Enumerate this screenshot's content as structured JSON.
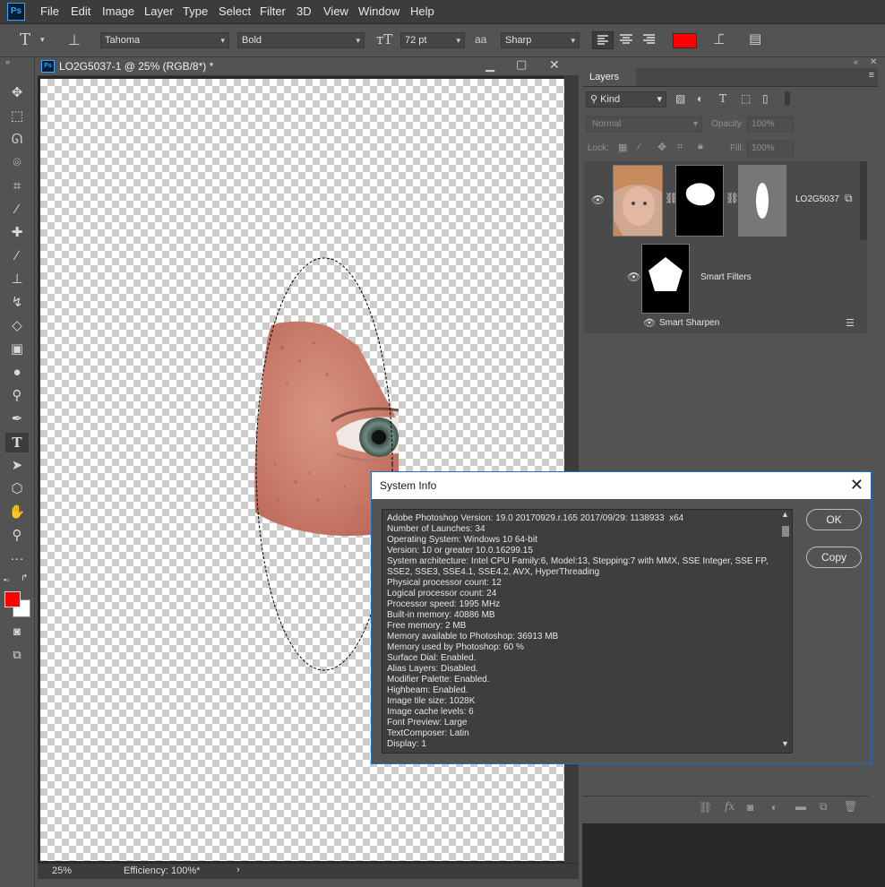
{
  "app": {
    "logo": "Ps"
  },
  "menu": [
    "File",
    "Edit",
    "Image",
    "Layer",
    "Type",
    "Select",
    "Filter",
    "3D",
    "View",
    "Window",
    "Help"
  ],
  "options_bar": {
    "font_family": "Tahoma",
    "font_style": "Bold",
    "font_size": "72 pt",
    "antialias_icon": "aa",
    "antialias": "Sharp",
    "color_swatch": "#ff0000"
  },
  "document": {
    "title": "LO2G5037-1 @ 25% (RGB/8*) *",
    "zoom": "25%",
    "status": "Efficiency: 100%*"
  },
  "layers_panel": {
    "tab": "Layers",
    "filter_kind": "Kind",
    "blend_mode": "Normal",
    "opacity_label": "Opacity:",
    "opacity": "100%",
    "lock_label": "Lock:",
    "fill_label": "Fill:",
    "fill": "100%",
    "layer_name": "LO2G5037",
    "smart_filters": "Smart Filters",
    "smart_sharpen": "Smart Sharpen"
  },
  "dialog": {
    "title": "System Info",
    "ok": "OK",
    "copy": "Copy",
    "lines": [
      "Adobe Photoshop Version: 19.0 20170929.r.165 2017/09/29: 1138933  x64",
      "Number of Launches: 34",
      "Operating System: Windows 10 64-bit",
      "Version: 10 or greater 10.0.16299.15",
      "System architecture: Intel CPU Family:6, Model:13, Stepping:7 with MMX, SSE Integer, SSE FP,",
      "SSE2, SSE3, SSE4.1, SSE4.2, AVX, HyperThreading",
      "Physical processor count: 12",
      "Logical processor count: 24",
      "Processor speed: 1995 MHz",
      "Built-in memory: 40886 MB",
      "Free memory: 2 MB",
      "Memory available to Photoshop: 36913 MB",
      "Memory used by Photoshop: 60 %",
      "Surface Dial: Enabled.",
      "Alias Layers: Disabled.",
      "Modifier Palette: Enabled.",
      "Highbeam: Enabled.",
      "Image tile size: 1028K",
      "Image cache levels: 6",
      "Font Preview: Large",
      "TextComposer: Latin",
      "Display: 1"
    ]
  },
  "colors": {
    "foreground": "#ff0000",
    "background": "#ffffff",
    "accent": "#1c6fc7"
  },
  "icons": [
    "move-icon",
    "marquee-icon",
    "lasso-icon",
    "quick-select-icon",
    "crop-icon",
    "eyedropper-icon",
    "healing-icon",
    "brush-icon",
    "stamp-icon",
    "history-brush-icon",
    "eraser-icon",
    "gradient-icon",
    "blur-icon",
    "dodge-icon",
    "pen-icon",
    "type-icon",
    "path-select-icon",
    "shape-icon",
    "hand-icon",
    "zoom-icon",
    "more-tools-icon"
  ]
}
